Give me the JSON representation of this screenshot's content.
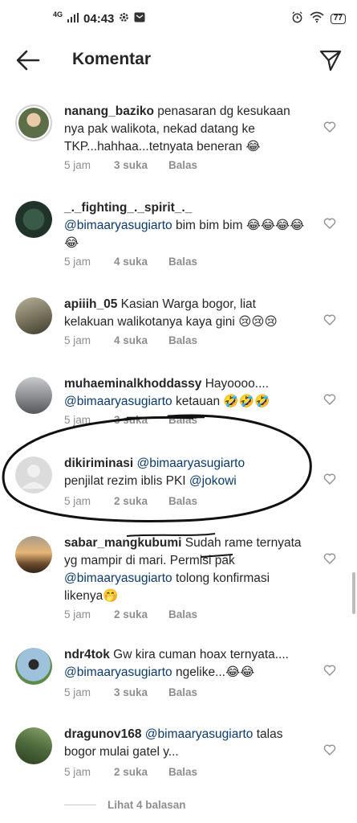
{
  "status_bar": {
    "network": "4G",
    "time": "04:43",
    "battery": "77"
  },
  "header": {
    "title": "Komentar"
  },
  "comments": [
    {
      "username": "nanang_baziko",
      "text": "penasaran dg kesukaan nya pak walikota, nekad datang ke TKP...hahhaa...tetnyata beneran 😂",
      "time": "5 jam",
      "likes": "3 suka",
      "reply": "Balas",
      "avatar_color": "#6b8a5a"
    },
    {
      "username": "_._fighting_._spirit_._",
      "mention": "@bimaaryasugiarto",
      "text": " bim bim bim 😂😂😂😂😂",
      "time": "5 jam",
      "likes": "4 suka",
      "reply": "Balas",
      "avatar_color": "#2f4a3a"
    },
    {
      "username": "apiiih_05",
      "text": "Kasian Warga bogor, liat kelakuan walikotanya kaya gini 😢😢😢",
      "time": "5 jam",
      "likes": "4 suka",
      "reply": "Balas",
      "avatar_color": "#7c7a66"
    },
    {
      "username": "muhaeminalkhoddassy",
      "text": "Hayoooo....",
      "mention": "@bimaaryasugiarto",
      "text2": " ketauan 🤣🤣🤣",
      "time": "5 jam",
      "likes": "3 suka",
      "reply": "Balas",
      "avatar_color": "#8a8c90"
    },
    {
      "username": "dikiriminasi",
      "mention": "@bimaaryasugiarto",
      "text": "penjilat rezim iblis PKI ",
      "mention2": "@jokowi",
      "time": "5 jam",
      "likes": "2 suka",
      "reply": "Balas",
      "avatar_color": "#dcdcdc"
    },
    {
      "username": "sabar_mangkubumi",
      "text": "Sudah rame ternyata yg mampir di mari. Permisi pak",
      "mention": "@bimaaryasugiarto",
      "text2": " tolong konfirmasi likenya🤭",
      "time": "5 jam",
      "likes": "2 suka",
      "reply": "Balas",
      "avatar_color": "#c79a62"
    },
    {
      "username": "ndr4tok",
      "text": "Gw kira cuman hoax ternyata....",
      "mention": "@bimaaryasugiarto",
      "text2": " ngelike...😂😂",
      "time": "5 jam",
      "likes": "3 suka",
      "reply": "Balas",
      "avatar_color": "#7da6c4"
    },
    {
      "username": "dragunov168",
      "mention": "@bimaaryasugiarto",
      "text": " talas bogor mulai gatel y...",
      "time": "5 jam",
      "likes": "2 suka",
      "reply": "Balas",
      "avatar_color": "#4d6a3c"
    }
  ],
  "view_replies": "Lihat 4 balasan",
  "icons": {
    "back": "arrow-left-icon",
    "send": "send-icon",
    "like": "heart-outline-icon"
  }
}
